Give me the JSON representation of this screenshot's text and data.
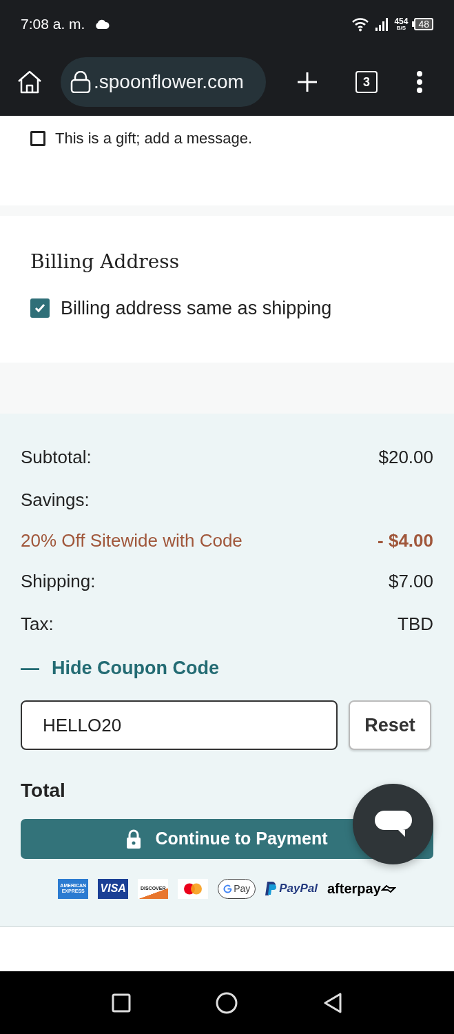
{
  "status_bar": {
    "time": "7:08 a. m.",
    "net_speed": "454",
    "net_unit": "B/S",
    "battery": "48"
  },
  "browser": {
    "url": ".spoonflower.com",
    "tab_count": "3"
  },
  "gift": {
    "label": "This is a gift; add a message.",
    "checked": false
  },
  "billing": {
    "title": "Billing Address",
    "same_as_shipping": {
      "label": "Billing address same as shipping",
      "checked": true
    }
  },
  "summary": {
    "lines": [
      {
        "kind": "row",
        "label": "Subtotal:",
        "value": "$20.00"
      },
      {
        "kind": "heading",
        "label": "Savings:"
      },
      {
        "kind": "discount",
        "label": "20% Off Sitewide with Code",
        "value": "- $4.00"
      },
      {
        "kind": "row",
        "label": "Shipping:",
        "value": "$7.00"
      },
      {
        "kind": "row",
        "label": "Tax:",
        "value": "TBD"
      }
    ],
    "coupon_toggle": {
      "icon": "—",
      "label": "Hide Coupon Code",
      "expanded": true
    },
    "coupon_value": "HELLO20",
    "reset_button": "Reset",
    "total_label": "Total",
    "pay_button": "Continue to Payment",
    "payment_methods": [
      {
        "kind": "amex",
        "lines": [
          "AMERICAN",
          "EXPRESS"
        ]
      },
      {
        "kind": "visa",
        "label": "VISA"
      },
      {
        "kind": "discover",
        "label": "DISCOVER"
      },
      {
        "kind": "mastercard"
      },
      {
        "kind": "gpay",
        "label": "Pay"
      },
      {
        "kind": "paypal",
        "label": "PayPal"
      },
      {
        "kind": "afterpay",
        "label": "afterpay"
      }
    ]
  }
}
